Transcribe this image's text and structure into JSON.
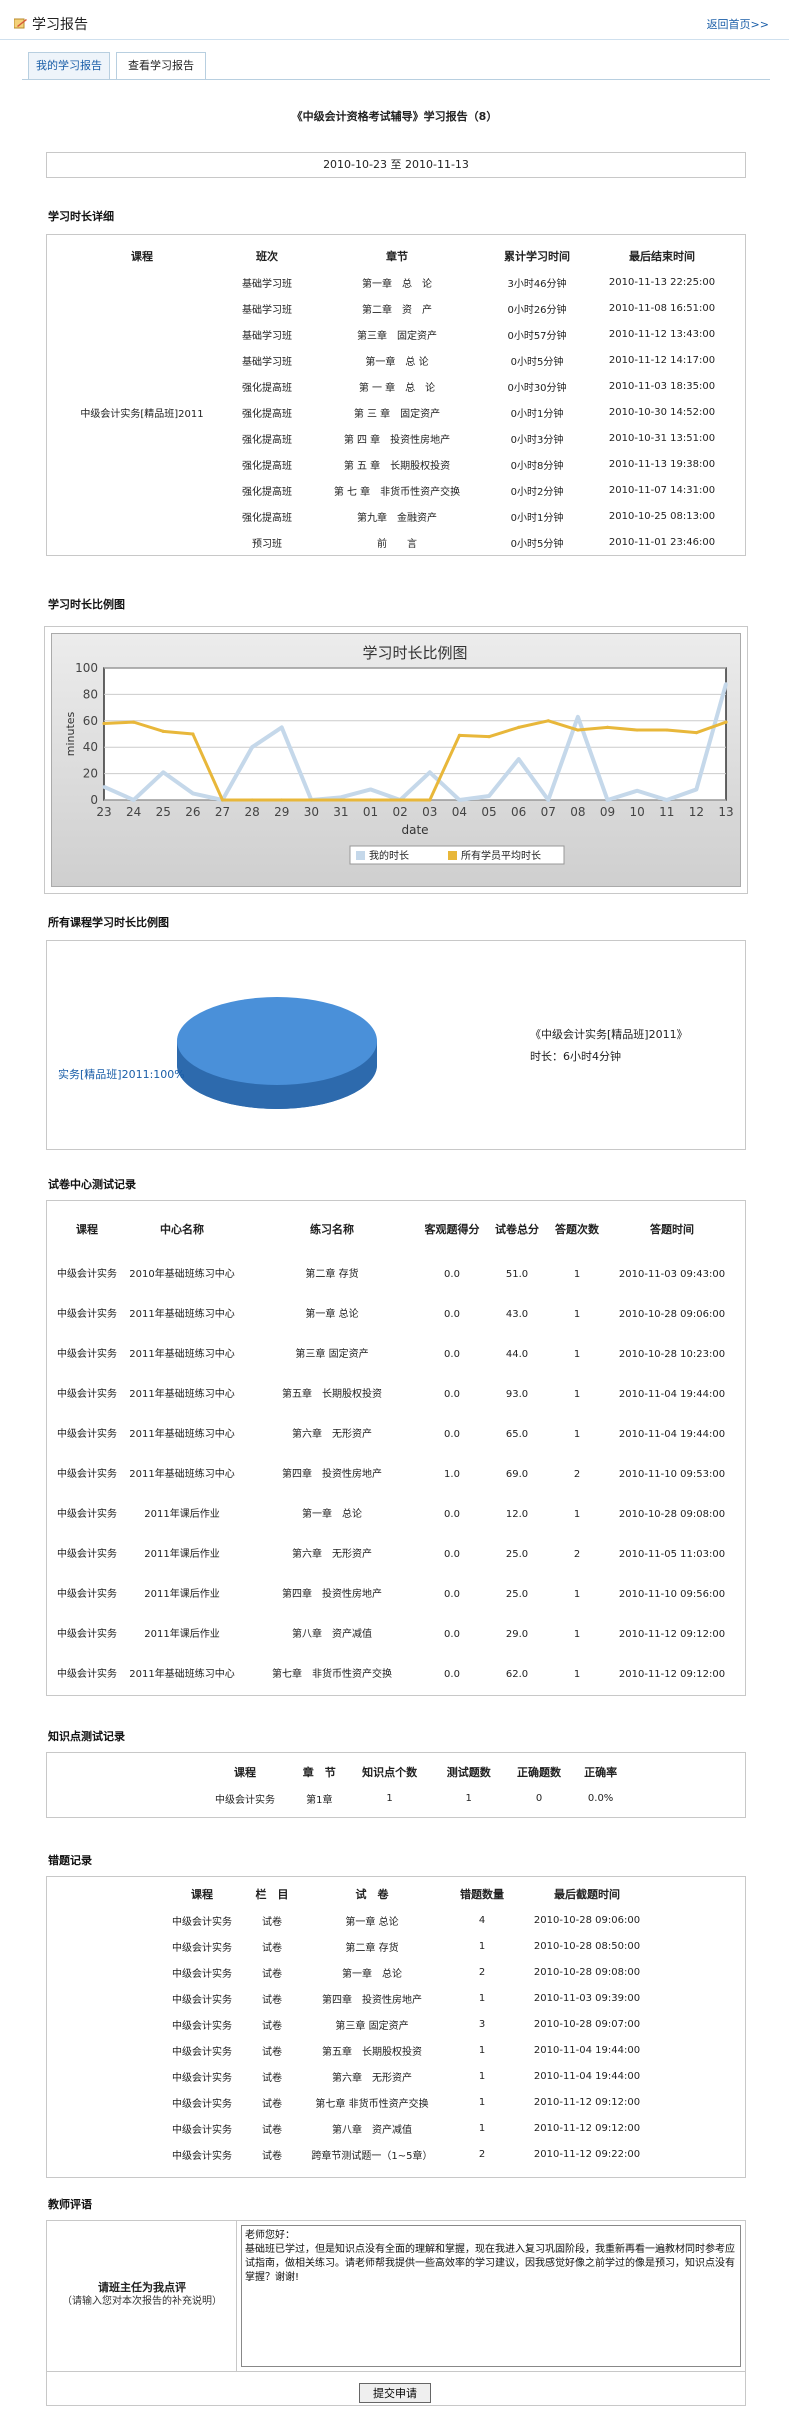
{
  "header": {
    "title": "学习报告",
    "home_link": "返回首页>>"
  },
  "tabs": [
    {
      "label": "我的学习报告"
    },
    {
      "label": "查看学习报告"
    }
  ],
  "report": {
    "title": "《中级会计资格考试辅导》学习报告（8）",
    "date_from": "2010-10-23",
    "date_sep": "至",
    "date_to": "2010-11-13"
  },
  "sections": {
    "study_time": "学习时长详细",
    "ratio_chart": "学习时长比例图",
    "all_courses": "所有课程学习时长比例图",
    "paper_tests": "试卷中心测试记录",
    "knowledge": "知识点测试记录",
    "mistakes": "错题记录",
    "comments": "教师评语"
  },
  "study_table": {
    "headers": [
      "课程",
      "班次",
      "章节",
      "累计学习时间",
      "最后结束时间"
    ],
    "course": "中级会计实务[精品班]2011",
    "rows": [
      [
        "基础学习班",
        "第一章　总　论",
        "3小时46分钟",
        "2010-11-13 22:25:00"
      ],
      [
        "基础学习班",
        "第二章　资　产",
        "0小时26分钟",
        "2010-11-08 16:51:00"
      ],
      [
        "基础学习班",
        "第三章　固定资产",
        "0小时57分钟",
        "2010-11-12 13:43:00"
      ],
      [
        "基础学习班",
        "第一章　总 论",
        "0小时5分钟",
        "2010-11-12 14:17:00"
      ],
      [
        "强化提高班",
        "第 一 章　总　论",
        "0小时30分钟",
        "2010-11-03 18:35:00"
      ],
      [
        "强化提高班",
        "第 三 章　固定资产",
        "0小时1分钟",
        "2010-10-30 14:52:00"
      ],
      [
        "强化提高班",
        "第 四 章　投资性房地产",
        "0小时3分钟",
        "2010-10-31 13:51:00"
      ],
      [
        "强化提高班",
        "第 五 章　长期股权投资",
        "0小时8分钟",
        "2010-11-13 19:38:00"
      ],
      [
        "强化提高班",
        "第 七 章　非货币性资产交换",
        "0小时2分钟",
        "2010-11-07 14:31:00"
      ],
      [
        "强化提高班",
        "第九章　金融资产",
        "0小时1分钟",
        "2010-10-25 08:13:00"
      ],
      [
        "预习班",
        "前　　言",
        "0小时5分钟",
        "2010-11-01 23:46:00"
      ]
    ]
  },
  "chart_data": {
    "type": "line",
    "title": "学习时长比例图",
    "xlabel": "date",
    "ylabel": "minutes",
    "ylim": [
      0,
      100
    ],
    "grid": true,
    "legend": "bottom",
    "categories": [
      "23",
      "24",
      "25",
      "26",
      "27",
      "28",
      "29",
      "30",
      "31",
      "01",
      "02",
      "03",
      "04",
      "05",
      "06",
      "07",
      "08",
      "09",
      "10",
      "11",
      "12",
      "13"
    ],
    "series": [
      {
        "name": "我的时长",
        "color": "#c5d8ea",
        "values": [
          10,
          0,
          21,
          5,
          0,
          40,
          55,
          0,
          2,
          8,
          0,
          21,
          0,
          3,
          31,
          0,
          63,
          0,
          7,
          0,
          8,
          88
        ]
      },
      {
        "name": "所有学员平均时长",
        "color": "#e8b73a",
        "values": [
          58,
          59,
          52,
          50,
          0,
          0,
          0,
          0,
          0,
          0,
          0,
          0,
          49,
          48,
          55,
          60,
          53,
          55,
          53,
          53,
          51,
          59
        ]
      }
    ]
  },
  "pie": {
    "label_left": "实务[精品班]2011:100%",
    "course": "《中级会计实务[精品班]2011》",
    "time_label": "时长：6小时4分钟",
    "color": "#4a90d9"
  },
  "paper_table": {
    "headers": [
      "课程",
      "中心名称",
      "练习名称",
      "客观题得分",
      "试卷总分",
      "答题次数",
      "答题时间"
    ],
    "rows": [
      [
        "中级会计实务",
        "2010年基础班练习中心",
        "第二章 存货",
        "0.0",
        "51.0",
        "1",
        "2010-11-03 09:43:00"
      ],
      [
        "中级会计实务",
        "2011年基础班练习中心",
        "第一章 总论",
        "0.0",
        "43.0",
        "1",
        "2010-10-28 09:06:00"
      ],
      [
        "中级会计实务",
        "2011年基础班练习中心",
        "第三章 固定资产",
        "0.0",
        "44.0",
        "1",
        "2010-10-28 10:23:00"
      ],
      [
        "中级会计实务",
        "2011年基础班练习中心",
        "第五章　长期股权投资",
        "0.0",
        "93.0",
        "1",
        "2010-11-04 19:44:00"
      ],
      [
        "中级会计实务",
        "2011年基础班练习中心",
        "第六章　无形资产",
        "0.0",
        "65.0",
        "1",
        "2010-11-04 19:44:00"
      ],
      [
        "中级会计实务",
        "2011年基础班练习中心",
        "第四章　投资性房地产",
        "1.0",
        "69.0",
        "2",
        "2010-11-10 09:53:00"
      ],
      [
        "中级会计实务",
        "2011年课后作业",
        "第一章　总论",
        "0.0",
        "12.0",
        "1",
        "2010-10-28 09:08:00"
      ],
      [
        "中级会计实务",
        "2011年课后作业",
        "第六章　无形资产",
        "0.0",
        "25.0",
        "2",
        "2010-11-05 11:03:00"
      ],
      [
        "中级会计实务",
        "2011年课后作业",
        "第四章　投资性房地产",
        "0.0",
        "25.0",
        "1",
        "2010-11-10 09:56:00"
      ],
      [
        "中级会计实务",
        "2011年课后作业",
        "第八章　资产减值",
        "0.0",
        "29.0",
        "1",
        "2010-11-12 09:12:00"
      ],
      [
        "中级会计实务",
        "2011年基础班练习中心",
        "第七章　非货币性资产交换",
        "0.0",
        "62.0",
        "1",
        "2010-11-12 09:12:00"
      ]
    ]
  },
  "knowledge_table": {
    "headers": [
      "课程",
      "章　节",
      "知识点个数",
      "测试题数",
      "正确题数",
      "正确率"
    ],
    "rows": [
      [
        "中级会计实务",
        "第1章",
        "1",
        "1",
        "0",
        "0.0%"
      ]
    ]
  },
  "mistake_table": {
    "headers": [
      "课程",
      "栏　目",
      "试　卷",
      "错题数量",
      "最后截题时间"
    ],
    "rows": [
      [
        "中级会计实务",
        "试卷",
        "第一章 总论",
        "4",
        "2010-10-28 09:06:00"
      ],
      [
        "中级会计实务",
        "试卷",
        "第二章 存货",
        "1",
        "2010-10-28 08:50:00"
      ],
      [
        "中级会计实务",
        "试卷",
        "第一章　总论",
        "2",
        "2010-10-28 09:08:00"
      ],
      [
        "中级会计实务",
        "试卷",
        "第四章　投资性房地产",
        "1",
        "2010-11-03 09:39:00"
      ],
      [
        "中级会计实务",
        "试卷",
        "第三章 固定资产",
        "3",
        "2010-10-28 09:07:00"
      ],
      [
        "中级会计实务",
        "试卷",
        "第五章　长期股权投资",
        "1",
        "2010-11-04 19:44:00"
      ],
      [
        "中级会计实务",
        "试卷",
        "第六章　无形资产",
        "1",
        "2010-11-04 19:44:00"
      ],
      [
        "中级会计实务",
        "试卷",
        "第七章 非货币性资产交换",
        "1",
        "2010-11-12 09:12:00"
      ],
      [
        "中级会计实务",
        "试卷",
        "第八章　资产减值",
        "1",
        "2010-11-12 09:12:00"
      ],
      [
        "中级会计实务",
        "试卷",
        "跨章节测试题一（1~5章）",
        "2",
        "2010-11-12 09:22:00"
      ]
    ]
  },
  "comment": {
    "label": "请班主任为我点评",
    "hint": "（请输入您对本次报告的补充说明）",
    "text": "老师您好：\n基础班已学过，但是知识点没有全面的理解和掌握，现在我进入复习巩固阶段，我重新再看一遍教材同时参考应试指南，做相关练习。请老师帮我提供一些高效率的学习建议，因我感觉好像之前学过的像是预习，知识点没有掌握？谢谢!",
    "submit": "提交申请"
  }
}
